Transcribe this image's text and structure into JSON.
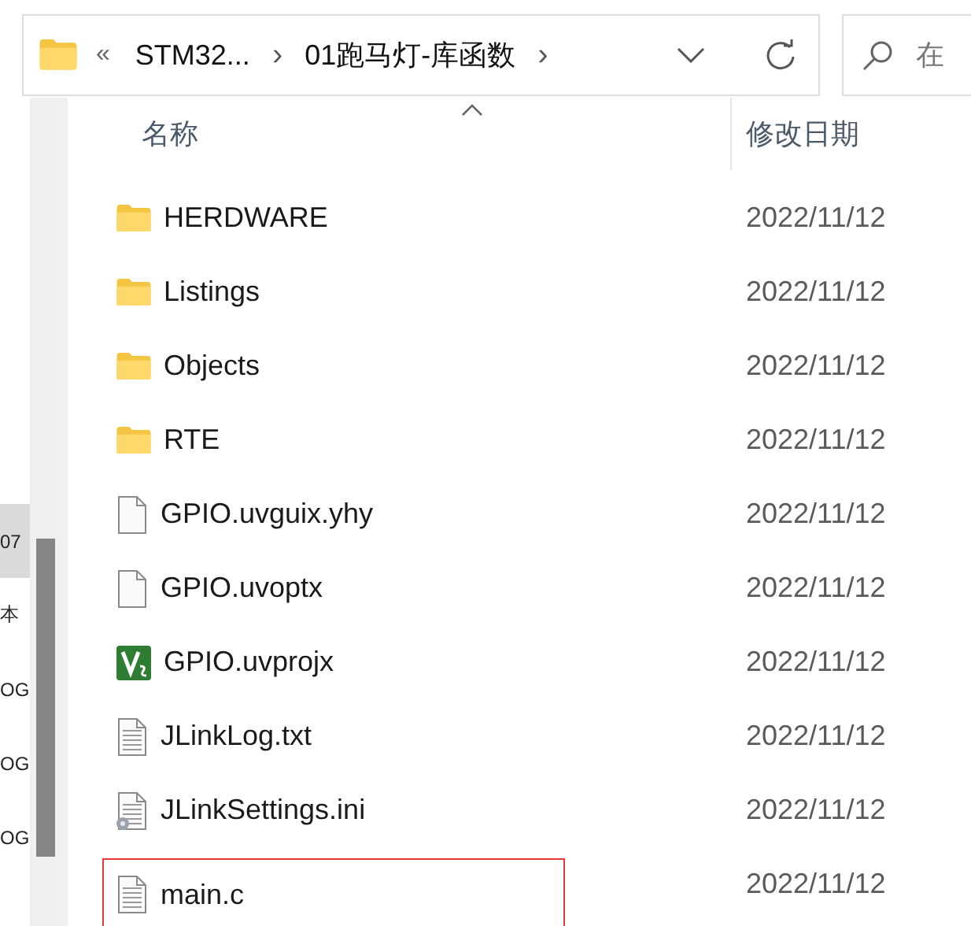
{
  "address_bar": {
    "overflow": "«",
    "crumbs": [
      {
        "label": "STM32..."
      },
      {
        "label": "01跑马灯-库函数"
      }
    ],
    "separator": "›"
  },
  "search": {
    "placeholder": "在"
  },
  "sidebar": {
    "items": [
      {
        "label": "07",
        "selected": true
      },
      {
        "label": "本",
        "selected": false
      },
      {
        "label": "OG",
        "selected": false
      },
      {
        "label": "OG",
        "selected": false
      },
      {
        "label": "OG",
        "selected": false
      }
    ]
  },
  "table": {
    "columns": [
      {
        "label": "名称",
        "sorted": true
      },
      {
        "label": "修改日期",
        "sorted": false
      }
    ],
    "rows": [
      {
        "name": "HERDWARE",
        "kind": "folder",
        "date": "2022/11/12",
        "highlighted": false
      },
      {
        "name": "Listings",
        "kind": "folder",
        "date": "2022/11/12",
        "highlighted": false
      },
      {
        "name": "Objects",
        "kind": "folder",
        "date": "2022/11/12",
        "highlighted": false
      },
      {
        "name": "RTE",
        "kind": "folder",
        "date": "2022/11/12",
        "highlighted": false
      },
      {
        "name": "GPIO.uvguix.yhy",
        "kind": "blank",
        "date": "2022/11/12",
        "highlighted": false
      },
      {
        "name": "GPIO.uvoptx",
        "kind": "blank",
        "date": "2022/11/12",
        "highlighted": false
      },
      {
        "name": "GPIO.uvprojx",
        "kind": "project",
        "date": "2022/11/12",
        "highlighted": false
      },
      {
        "name": "JLinkLog.txt",
        "kind": "text",
        "date": "2022/11/12",
        "highlighted": false
      },
      {
        "name": "JLinkSettings.ini",
        "kind": "settings",
        "date": "2022/11/12",
        "highlighted": false
      },
      {
        "name": "main.c",
        "kind": "text",
        "date": "2022/11/12",
        "highlighted": true
      }
    ]
  }
}
